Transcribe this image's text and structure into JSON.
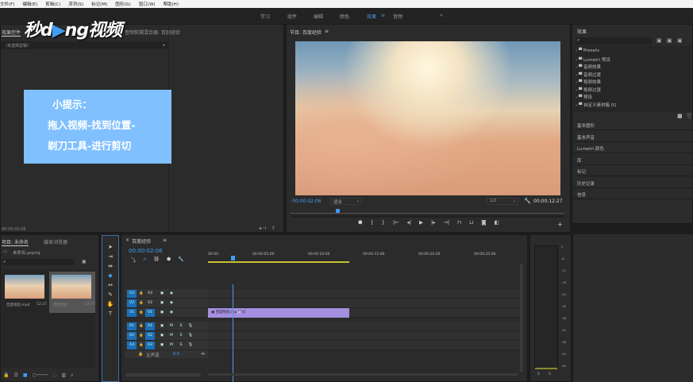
{
  "menu": [
    "文件(F)",
    "编辑(E)",
    "剪辑(C)",
    "序列(S)",
    "标记(M)",
    "图形(G)",
    "窗口(W)",
    "帮助(H)"
  ],
  "workspaces": [
    "学习",
    "组件",
    "编辑",
    "颜色",
    "效果",
    "音频"
  ],
  "active_workspace": "效果",
  "logo": "秒dong视频",
  "effect_controls": {
    "tab": "效果控件",
    "tab2": "音频剪辑混合器: 百度经验",
    "no_clip": "（未选择剪辑）",
    "timecode": "00:00:02:06"
  },
  "tip": {
    "line1": "小提示：",
    "line2": "拖入视频-找到位置-",
    "line3": "剃刀工具-进行剪切"
  },
  "program": {
    "title": "节目: 百度经验",
    "timecode": "00:00:02:06",
    "fit": "适合",
    "quality": "1/2",
    "duration": "00:00:12:27",
    "playhead_fraction": 0.17
  },
  "effects": {
    "title": "效果",
    "search_placeholder": "",
    "items": [
      "Presets",
      "Lumetri 预设",
      "音频效果",
      "音频过渡",
      "视频效果",
      "视频过渡",
      "预设",
      "自定义素材箱 01"
    ],
    "sections": [
      "基本图形",
      "基本声音",
      "Lumetri 颜色",
      "库",
      "标记",
      "历史记录",
      "信息"
    ]
  },
  "project": {
    "tab": "项目: 未命名",
    "tab2": "媒体浏览器",
    "file": "未命名.prproj",
    "items": [
      {
        "name": "百度经验.mp4",
        "duration": "12:27"
      },
      {
        "name": "百度经验",
        "duration": "12:27"
      }
    ]
  },
  "timeline": {
    "title": "百度经验",
    "timecode": "00:00:02:06",
    "ruler": [
      "00:00",
      "00:00:05:00",
      "00:00:10:00",
      "00:00:15:00",
      "00:00:20:00",
      "00:00:25:00"
    ],
    "video_tracks": [
      "V3",
      "V2",
      "V1"
    ],
    "audio_tracks": [
      "A1",
      "A2",
      "A3"
    ],
    "master_label": "主声道",
    "master_value": "0.0",
    "clip_label": "百度经验.mp4 [V]",
    "m": "M",
    "s": "S"
  },
  "meter": {
    "scale": [
      "0",
      "-6",
      "-12",
      "-18",
      "-24",
      "-30",
      "-36",
      "-42",
      "-48",
      "-54",
      "-60"
    ],
    "solo": [
      "S",
      "S"
    ]
  }
}
